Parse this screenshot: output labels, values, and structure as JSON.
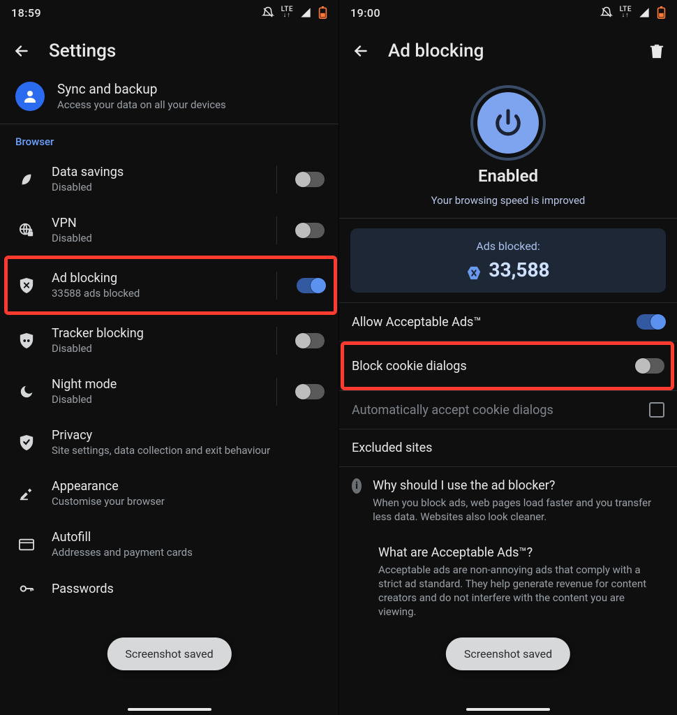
{
  "left": {
    "status": {
      "time": "18:59",
      "network": "LTE"
    },
    "title": "Settings",
    "sync": {
      "title": "Sync and backup",
      "subtitle": "Access your data on all your devices"
    },
    "section": "Browser",
    "items": [
      {
        "title": "Data savings",
        "subtitle": "Disabled",
        "toggle": "off"
      },
      {
        "title": "VPN",
        "subtitle": "Disabled",
        "toggle": "off"
      },
      {
        "title": "Ad blocking",
        "subtitle": "33588 ads blocked",
        "toggle": "on",
        "highlight": true
      },
      {
        "title": "Tracker blocking",
        "subtitle": "Disabled",
        "toggle": "off"
      },
      {
        "title": "Night mode",
        "subtitle": "Disabled",
        "toggle": "off"
      },
      {
        "title": "Privacy",
        "subtitle": "Site settings, data collection and exit behaviour"
      },
      {
        "title": "Appearance",
        "subtitle": "Customise your browser"
      },
      {
        "title": "Autofill",
        "subtitle": "Addresses and payment cards"
      },
      {
        "title": "Passwords",
        "subtitle": ""
      }
    ],
    "toast": "Screenshot saved"
  },
  "right": {
    "status": {
      "time": "19:00",
      "network": "LTE"
    },
    "title": "Ad blocking",
    "hero": {
      "label": "Enabled",
      "sub": "Your browsing speed is improved"
    },
    "card": {
      "label": "Ads blocked:",
      "value": "33,588"
    },
    "rows": {
      "acceptable": "Allow Acceptable Ads™",
      "cookie": "Block cookie dialogs",
      "autocookie": "Automatically accept cookie dialogs",
      "excluded": "Excluded sites"
    },
    "faq": {
      "q1": "Why should I use the ad blocker?",
      "a1": "When you block ads, web pages load faster and you transfer less data. Websites also look cleaner.",
      "q2": "What are Acceptable Ads™?",
      "a2": "Acceptable ads are non-annoying ads that comply with a strict ad standard. They help generate revenue for content creators and do not interfere with the content you are viewing."
    },
    "toast": "Screenshot saved"
  }
}
